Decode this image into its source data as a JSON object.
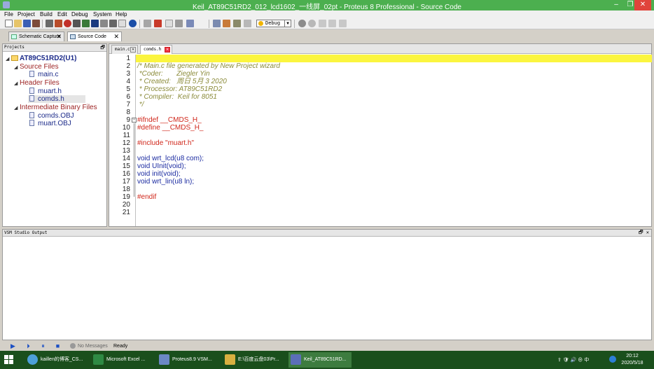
{
  "window": {
    "title": "Keil_AT89C51RD2_012_lcd1602_一线屏_02pt - Proteus 8 Professional - Source Code",
    "min_glyph": "–",
    "max_glyph": "❐",
    "close_glyph": "✕"
  },
  "menu": [
    "File",
    "Project",
    "Build",
    "Edit",
    "Debug",
    "System",
    "Help"
  ],
  "toolbar": {
    "build_config": "Debug"
  },
  "main_tabs": [
    {
      "label": "Schematic Capture",
      "close": "✕"
    },
    {
      "label": "Source Code",
      "close": "✕"
    }
  ],
  "projects": {
    "header": "Projects",
    "pin": "🗗",
    "root": "AT89C51RD2(U1)",
    "groups": [
      {
        "label": "Source Files",
        "files": [
          "main.c"
        ]
      },
      {
        "label": "Header Files",
        "files": [
          "muart.h",
          "comds.h"
        ]
      },
      {
        "label": "Intermediate Binary Files",
        "files": [
          "comds.OBJ",
          "muart.OBJ"
        ]
      }
    ]
  },
  "editor": {
    "tabs": [
      {
        "label": "main.c",
        "close": "✕"
      },
      {
        "label": "comds.h",
        "close": "✕"
      }
    ],
    "line_numbers": [
      "1",
      "2",
      "3",
      "4",
      "5",
      "6",
      "7",
      "8",
      "9",
      "10",
      "11",
      "12",
      "13",
      "14",
      "15",
      "16",
      "17",
      "18",
      "19",
      "20",
      "21"
    ],
    "lines": [
      "",
      "/* Main.c file generated by New Project wizard",
      " *Coder:       Ziegler Yin",
      " * Created:   周日 5月 3 2020",
      " * Processor: AT89C51RD2",
      " * Compiler:  Keil for 8051",
      " */",
      "",
      "#ifndef __CMDS_H_",
      "#define __CMDS_H_",
      "",
      "#include \"muart.h\"",
      "",
      "void wrt_lcd(u8 com);",
      "void UInit(void);",
      "void init(void);",
      "void wrt_lin(u8 ln);",
      "",
      "#endif",
      "",
      ""
    ],
    "fold_glyph": "−"
  },
  "vsm": {
    "header": "VSM Studio Output",
    "controls": "🗗 ✕"
  },
  "status": {
    "play": "▶",
    "step": "⏵",
    "pause": "⏸",
    "stop": "■",
    "messages": "No Messages",
    "state": "Ready"
  },
  "taskbar": {
    "items": [
      {
        "label": "kaillen的博客_CS...",
        "color": "#4da0d8"
      },
      {
        "label": "Microsoft Excel ...",
        "color": "#2f8a44"
      },
      {
        "label": "Proteus8.9 VSM...",
        "color": "#6b88c4"
      },
      {
        "label": "E:\\百度云盘03\\Pr...",
        "color": "#d8b040"
      },
      {
        "label": "Keil_AT89C51RD...",
        "color": "#5b6fb8"
      }
    ],
    "tray_text": "⇪ 🛡 🔊 ⊕ 中",
    "time": "20:12",
    "date": "2020/5/18"
  }
}
